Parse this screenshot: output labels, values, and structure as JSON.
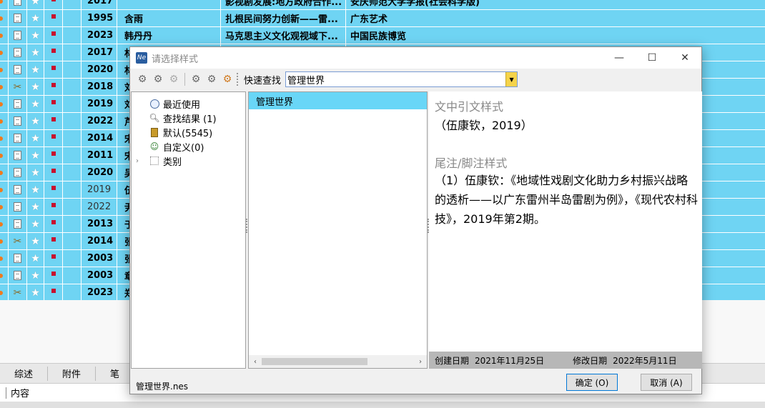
{
  "records": [
    {
      "year": "2017",
      "author": "",
      "title": "影视剧发展:地方政府合作...",
      "source": "安庆师范大学学报(社会科学版)",
      "attach": "doc",
      "light": false
    },
    {
      "year": "1995",
      "author": "含雨",
      "title": "扎根民间努力创新——雷...",
      "source": "广东艺术",
      "attach": "doc",
      "light": false
    },
    {
      "year": "2023",
      "author": "韩丹丹",
      "title": "马克思主义文化观视域下...",
      "source": "中国民族博览",
      "attach": "doc",
      "light": false
    },
    {
      "year": "2017",
      "author": "林",
      "title": "",
      "source": "",
      "attach": "doc",
      "light": false
    },
    {
      "year": "2020",
      "author": "林",
      "title": "",
      "source": "",
      "attach": "doc",
      "light": false
    },
    {
      "year": "2018",
      "author": "刘",
      "title": "",
      "source": "",
      "attach": "clip",
      "light": false
    },
    {
      "year": "2019",
      "author": "刘",
      "title": "",
      "source": "",
      "attach": "doc",
      "light": false
    },
    {
      "year": "2022",
      "author": "芦",
      "title": "",
      "source": "",
      "attach": "doc",
      "light": false
    },
    {
      "year": "2014",
      "author": "宋",
      "title": "",
      "source": "",
      "attach": "doc",
      "light": false
    },
    {
      "year": "2011",
      "author": "宋",
      "title": "",
      "source": "",
      "attach": "doc",
      "light": false
    },
    {
      "year": "2020",
      "author": "吴",
      "title": "",
      "source": "",
      "attach": "doc",
      "light": false
    },
    {
      "year": "2019",
      "author": "伍",
      "title": "",
      "source": "",
      "attach": "doc",
      "light": true
    },
    {
      "year": "2022",
      "author": "尹",
      "title": "",
      "source": "",
      "attach": "doc",
      "light": true
    },
    {
      "year": "2013",
      "author": "于",
      "title": "",
      "source": "",
      "attach": "doc",
      "light": false
    },
    {
      "year": "2014",
      "author": "张",
      "title": "",
      "source": "",
      "attach": "clip",
      "light": false
    },
    {
      "year": "2003",
      "author": "张",
      "title": "",
      "source": "",
      "attach": "doc",
      "light": false
    },
    {
      "year": "2003",
      "author": "章",
      "title": "",
      "source": "",
      "attach": "doc",
      "light": false
    },
    {
      "year": "2023",
      "author": "郑",
      "title": "",
      "source": "",
      "attach": "clip",
      "light": false
    }
  ],
  "bottom_tabs": [
    "综述",
    "附件",
    "笔"
  ],
  "content_label": "内容",
  "dialog": {
    "title": "请选择样式",
    "app_icon": "Ne",
    "quick_find_label": "快速查找",
    "quick_find_value": "管理世界",
    "tree": [
      {
        "label": "最近使用",
        "icon": "clock-icon"
      },
      {
        "label": "查找结果 (1)",
        "icon": "search-icon"
      },
      {
        "label": "默认(5545)",
        "icon": "book-icon"
      },
      {
        "label": "自定义(0)",
        "icon": "user-icon"
      },
      {
        "label": "类别",
        "icon": "grid-icon"
      }
    ],
    "styles": [
      "管理世界"
    ],
    "preview": {
      "intext_heading": "文中引文样式",
      "intext_value": "（伍康钦，2019）",
      "footnote_heading": "尾注/脚注样式",
      "footnote_value": "（1）伍康钦：《地域性戏剧文化助力乡村振兴战略的透析——以广东雷州半岛雷剧为例》，《现代农村科技》，2019年第2期。",
      "created_label": "创建日期",
      "created_value": "2021年11月25日",
      "modified_label": "修改日期",
      "modified_value": "2022年5月11日"
    },
    "file_name": "管理世界.nes",
    "ok_label": "确定 (O)",
    "cancel_label": "取消 (A)"
  }
}
